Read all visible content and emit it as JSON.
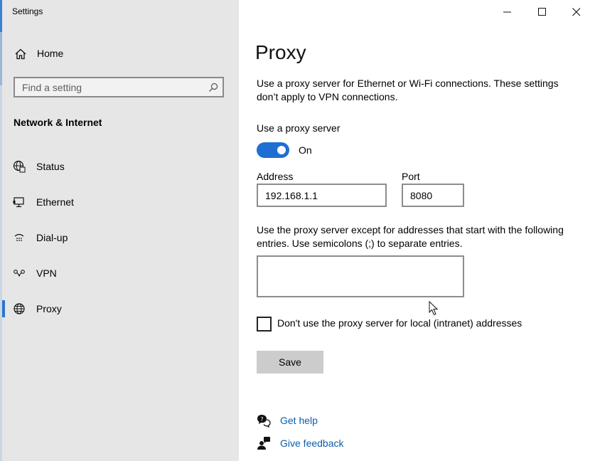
{
  "window": {
    "title": "Settings",
    "controls": {
      "minimize": "minimize",
      "maximize": "maximize",
      "close": "close"
    }
  },
  "sidebar": {
    "home_label": "Home",
    "search": {
      "placeholder": "Find a setting",
      "value": ""
    },
    "section_title": "Network & Internet",
    "items": [
      {
        "label": "Status",
        "icon": "globe-status-icon"
      },
      {
        "label": "Ethernet",
        "icon": "ethernet-icon"
      },
      {
        "label": "Dial-up",
        "icon": "dialup-icon"
      },
      {
        "label": "VPN",
        "icon": "vpn-icon"
      },
      {
        "label": "Proxy",
        "icon": "globe-icon",
        "selected": true
      }
    ]
  },
  "main": {
    "page_title": "Proxy",
    "description": "Use a proxy server for Ethernet or Wi-Fi connections. These settings don’t apply to VPN connections.",
    "use_proxy_label": "Use a proxy server",
    "toggle": {
      "state_text": "On",
      "on": true
    },
    "address": {
      "label": "Address",
      "value": "192.168.1.1"
    },
    "port": {
      "label": "Port",
      "value": "8080"
    },
    "exceptions_label": "Use the proxy server except for addresses that start with the following entries. Use semicolons (;) to separate entries.",
    "exceptions_value": "",
    "local_checkbox": {
      "label": "Don't use the proxy server for local (intranet) addresses",
      "checked": false
    },
    "save_label": "Save",
    "links": {
      "help": "Get help",
      "feedback": "Give feedback"
    }
  },
  "colors": {
    "accent": "#1e6fd1",
    "sidebar_bg": "#e6e6e6",
    "link": "#0b5cad",
    "button_bg": "#cccccc"
  }
}
